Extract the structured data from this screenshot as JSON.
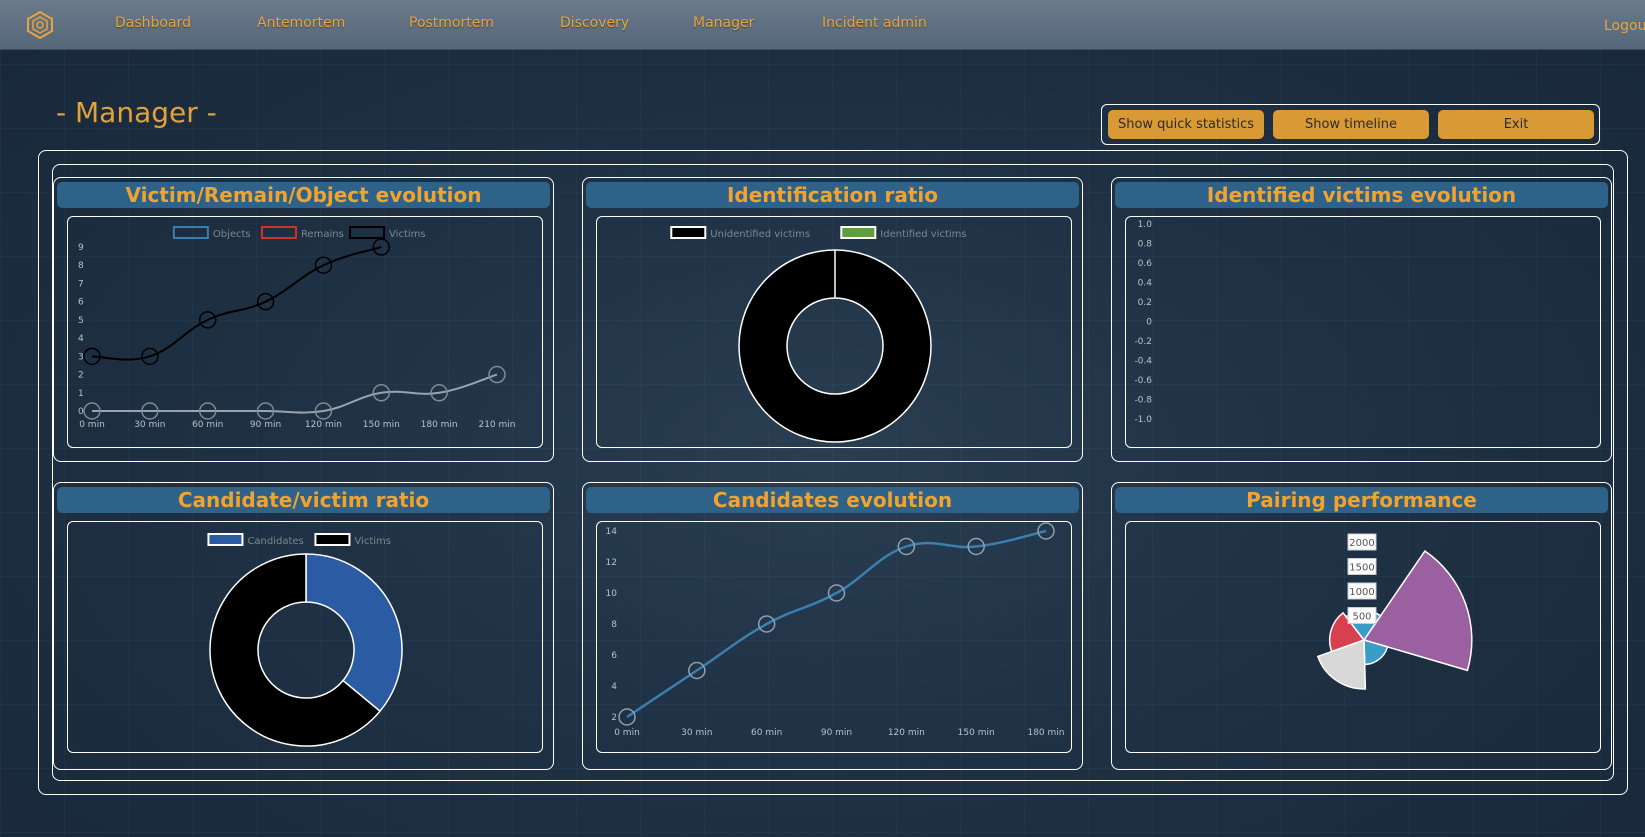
{
  "nav": {
    "items": [
      "Dashboard",
      "Antemortem",
      "Postmortem",
      "Discovery",
      "Manager",
      "Incident admin"
    ],
    "logout": "Logout"
  },
  "page": {
    "title": "- Manager -"
  },
  "actions": {
    "quick_stats": "Show quick statistics",
    "timeline": "Show timeline",
    "exit": "Exit"
  },
  "panels": {
    "vro": {
      "title": "Victim/Remain/Object evolution"
    },
    "idratio": {
      "title": "Identification ratio"
    },
    "idvictims": {
      "title": "Identified victims evolution"
    },
    "candratio": {
      "title": "Candidate/victim ratio"
    },
    "candevo": {
      "title": "Candidates evolution"
    },
    "pairing": {
      "title": "Pairing performance"
    }
  },
  "colors": {
    "accent": "#e2a13a",
    "panel_header": "#2f6288",
    "series_blue": "#3a7fb0",
    "series_red": "#d0312d",
    "candidates": "#2a5ba3",
    "identified": "#5e9e3e"
  },
  "chart_data": [
    {
      "id": "vro",
      "type": "line",
      "x": [
        "0 min",
        "30 min",
        "60 min",
        "90 min",
        "120 min",
        "150 min",
        "180 min",
        "210 min"
      ],
      "yticks": [
        "0",
        "1",
        "2",
        "3",
        "4",
        "5",
        "6",
        "7",
        "8",
        "9"
      ],
      "ylim": [
        0,
        9
      ],
      "series": [
        {
          "name": "Objects",
          "values": [
            0,
            0,
            0,
            0,
            0,
            1,
            1,
            2
          ]
        },
        {
          "name": "Remains",
          "values": []
        },
        {
          "name": "Victims",
          "values": [
            3,
            3,
            5,
            6,
            8,
            9
          ]
        }
      ],
      "legend": "top"
    },
    {
      "id": "idratio",
      "type": "pie",
      "labels": [
        "Unidentified victims",
        "Identified victims"
      ],
      "values": [
        1,
        0
      ],
      "legend": "top"
    },
    {
      "id": "idvictims",
      "type": "line",
      "yticks": [
        "1.0",
        "0.8",
        "0.6",
        "0.4",
        "0.2",
        "0",
        "-0.2",
        "-0.4",
        "-0.6",
        "-0.8",
        "-1.0"
      ],
      "ylim": [
        -1,
        1
      ],
      "series": []
    },
    {
      "id": "candratio",
      "type": "pie",
      "labels": [
        "Candidates",
        "Victims"
      ],
      "values": [
        36,
        64
      ],
      "legend": "top"
    },
    {
      "id": "candevo",
      "type": "line",
      "x": [
        "0 min",
        "30 min",
        "60 min",
        "90 min",
        "120 min",
        "150 min",
        "180 min"
      ],
      "yticks": [
        "2",
        "4",
        "6",
        "8",
        "10",
        "12",
        "14"
      ],
      "ylim": [
        2,
        14
      ],
      "series": [
        {
          "values": [
            2,
            5,
            8,
            10,
            13,
            13,
            14
          ]
        }
      ]
    },
    {
      "id": "pairing",
      "type": "polar-area",
      "ticks": [
        "500",
        "1000",
        "1500",
        "2000"
      ],
      "values": [
        2200,
        500,
        1000,
        700,
        600
      ],
      "colors": [
        "#9a60a0",
        "#3b9cc8",
        "#d8d8d8",
        "#d84050",
        "#3b9cc8"
      ]
    }
  ]
}
